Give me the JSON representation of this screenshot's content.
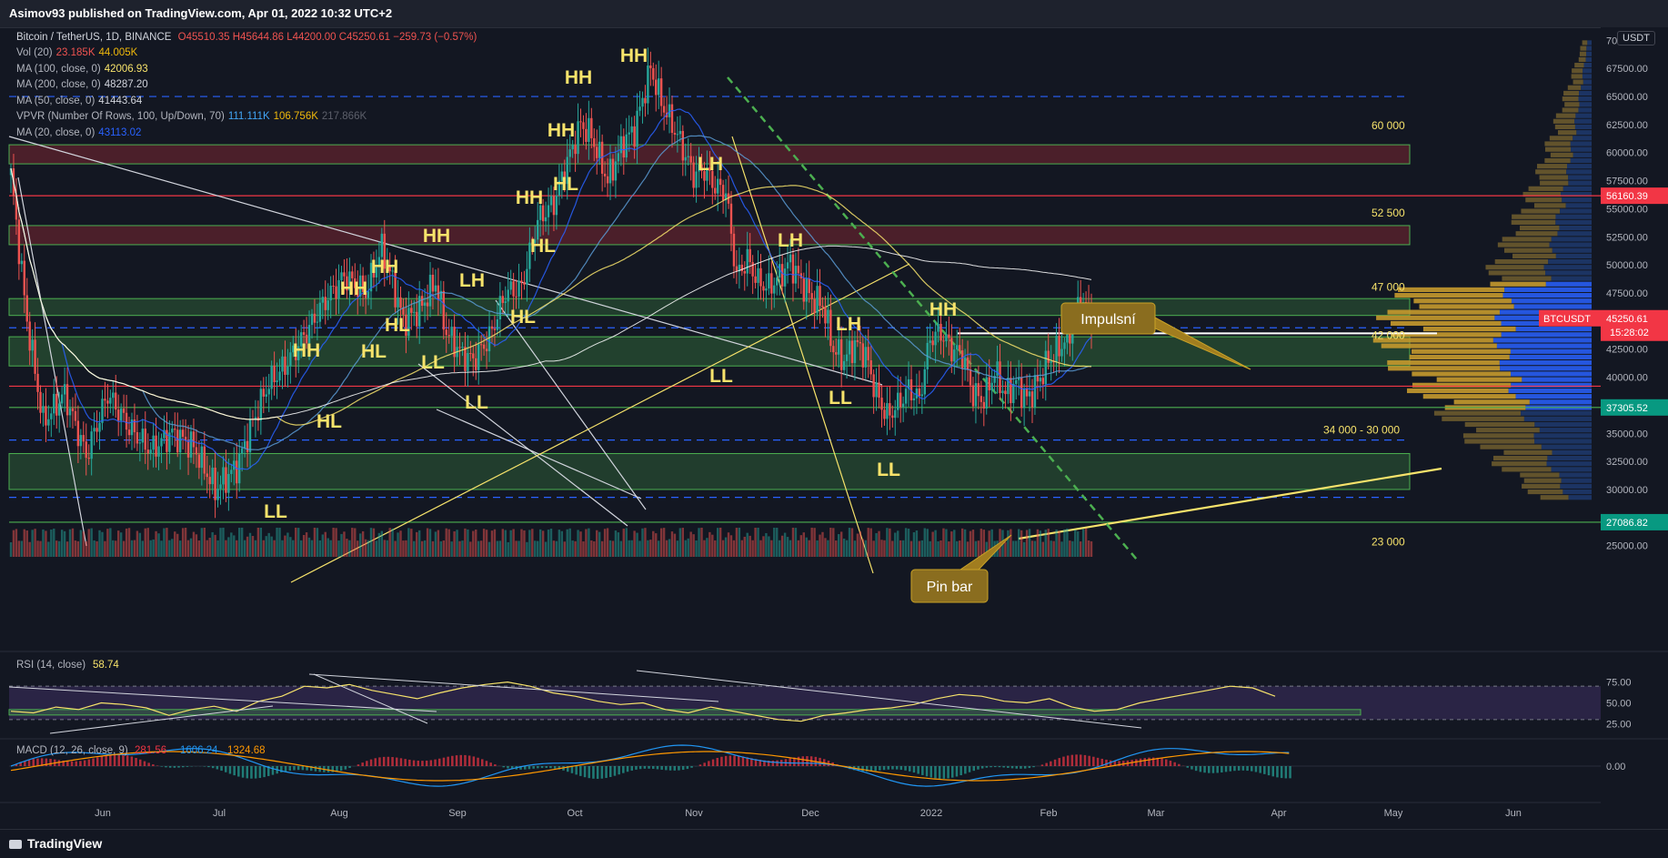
{
  "header": {
    "published": "Asimov93 published on TradingView.com, Apr 01, 2022 10:32 UTC+2"
  },
  "legend": {
    "symbol": {
      "name": "Bitcoin / TetherUS, 1D, BINANCE",
      "ohlc": "O45510.35  H45644.86  L44200.00  C45250.61  −259.73 (−0.57%)"
    },
    "rows": [
      {
        "label": "Vol (20)",
        "v1": "23.185K",
        "v2": "44.005K",
        "c1": "#ef5350",
        "c2": "#f0b90b"
      },
      {
        "label": "MA (100, close, 0)",
        "v1": "42006.93",
        "v2": "",
        "c1": "#f7e36b",
        "c2": ""
      },
      {
        "label": "MA (200, close, 0)",
        "v1": "48287.20",
        "v2": "",
        "c1": "#d1d4dc",
        "c2": ""
      },
      {
        "label": "MA (50, close, 0)",
        "v1": "41443.64",
        "v2": "",
        "c1": "#d1d4dc",
        "c2": ""
      },
      {
        "label": "VPVR (Number Of Rows, 100, Up/Down, 70)",
        "v1": "111.111K",
        "v2": "106.756K",
        "c1": "#42a5f5",
        "c2": "#f0b90b"
      },
      {
        "label": "MA (20, close, 0)",
        "v1": "43113.02",
        "v2": "",
        "c1": "#2962ff",
        "c2": ""
      }
    ],
    "vpvr_total": "217.866K"
  },
  "currency_badge": "USDT",
  "chart_data": {
    "type": "candlestick",
    "symbol": "BTCUSDT",
    "x_ticks": [
      "Jun",
      "Jul",
      "Aug",
      "Sep",
      "Oct",
      "Nov",
      "Dec",
      "2022",
      "Feb",
      "Mar",
      "Apr",
      "May",
      "Jun"
    ],
    "y_ticks": [
      "70000.00",
      "67500.00",
      "65000.00",
      "62500.00",
      "60000.00",
      "57500.00",
      "55000.00",
      "52500.00",
      "50000.00",
      "47500.00",
      "45000.00",
      "42500.00",
      "40000.00",
      "37500.00",
      "35000.00",
      "32500.00",
      "30000.00",
      "27500.00",
      "25000.00"
    ],
    "y_range": [
      24000,
      71000
    ],
    "price_path": [
      [
        0,
        58000
      ],
      [
        6,
        45000
      ],
      [
        12,
        36000
      ],
      [
        20,
        38500
      ],
      [
        28,
        33000
      ],
      [
        36,
        38500
      ],
      [
        44,
        35500
      ],
      [
        52,
        33500
      ],
      [
        60,
        35000
      ],
      [
        68,
        33800
      ],
      [
        76,
        30000
      ],
      [
        84,
        32000
      ],
      [
        90,
        36000
      ],
      [
        96,
        39500
      ],
      [
        102,
        41000
      ],
      [
        110,
        44000
      ],
      [
        116,
        46500
      ],
      [
        124,
        49000
      ],
      [
        132,
        47500
      ],
      [
        138,
        51500
      ],
      [
        142,
        48500
      ],
      [
        146,
        45000
      ],
      [
        152,
        46000
      ],
      [
        158,
        48500
      ],
      [
        162,
        44000
      ],
      [
        168,
        42000
      ],
      [
        172,
        41500
      ],
      [
        178,
        43500
      ],
      [
        184,
        47500
      ],
      [
        190,
        48000
      ],
      [
        196,
        54000
      ],
      [
        202,
        55500
      ],
      [
        206,
        58500
      ],
      [
        212,
        62500
      ],
      [
        216,
        61500
      ],
      [
        222,
        57500
      ],
      [
        228,
        61000
      ],
      [
        232,
        62000
      ],
      [
        238,
        67500
      ],
      [
        242,
        64500
      ],
      [
        248,
        61500
      ],
      [
        254,
        58000
      ],
      [
        258,
        58500
      ],
      [
        262,
        57000
      ],
      [
        266,
        56500
      ],
      [
        270,
        49000
      ],
      [
        274,
        50500
      ],
      [
        278,
        48500
      ],
      [
        282,
        48000
      ],
      [
        286,
        49000
      ],
      [
        290,
        50200
      ],
      [
        294,
        48500
      ],
      [
        298,
        47000
      ],
      [
        302,
        46500
      ],
      [
        306,
        42500
      ],
      [
        310,
        41500
      ],
      [
        314,
        43000
      ],
      [
        318,
        42000
      ],
      [
        322,
        38500
      ],
      [
        326,
        36500
      ],
      [
        330,
        37500
      ],
      [
        334,
        39000
      ],
      [
        338,
        38000
      ],
      [
        342,
        43500
      ],
      [
        346,
        44000
      ],
      [
        350,
        42500
      ],
      [
        354,
        42000
      ],
      [
        358,
        38500
      ],
      [
        362,
        38000
      ],
      [
        366,
        40500
      ],
      [
        370,
        38500
      ],
      [
        374,
        39500
      ],
      [
        378,
        38000
      ],
      [
        382,
        39500
      ],
      [
        386,
        41500
      ],
      [
        390,
        42500
      ],
      [
        394,
        44000
      ],
      [
        398,
        47000
      ],
      [
        402,
        45250
      ]
    ],
    "hlines": [
      {
        "price": 47000,
        "label": "47 000"
      },
      {
        "price": 42000,
        "label": "42 000"
      },
      {
        "price": 52500,
        "label": "52 500"
      },
      {
        "price": 60000,
        "label": "60 000"
      },
      {
        "price": 23000,
        "label": "23 000"
      }
    ],
    "zones_label": "34 000 - 30 000",
    "annotations": [
      {
        "text": "HH"
      },
      {
        "text": "HH"
      },
      {
        "text": "HH"
      },
      {
        "text": "HH"
      },
      {
        "text": "HH"
      },
      {
        "text": "HH"
      },
      {
        "text": "HH"
      },
      {
        "text": "HH"
      },
      {
        "text": "HH"
      },
      {
        "text": "HL"
      },
      {
        "text": "HL"
      },
      {
        "text": "HL"
      },
      {
        "text": "HL"
      },
      {
        "text": "HL"
      },
      {
        "text": "HL"
      },
      {
        "text": "LH"
      },
      {
        "text": "LH"
      },
      {
        "text": "LH"
      },
      {
        "text": "LH"
      },
      {
        "text": "LL"
      },
      {
        "text": "LL"
      },
      {
        "text": "LL"
      },
      {
        "text": "LL"
      },
      {
        "text": "LL"
      },
      {
        "text": "LL"
      },
      {
        "text": "LL"
      }
    ],
    "callouts": [
      {
        "text": "Impulsní"
      },
      {
        "text": "Pin bar"
      }
    ],
    "price_badges": [
      {
        "price": 56160.39,
        "text": "56160.39",
        "color": "#f23645"
      },
      {
        "price": 45250.61,
        "text": "BTCUSDT",
        "text2": "45250.61",
        "sub": "15:28:02",
        "color": "#f23645"
      },
      {
        "price": 37305.52,
        "text": "37305.52",
        "color": "#089981"
      },
      {
        "price": 27086.82,
        "text": "27086.82",
        "color": "#089981"
      }
    ]
  },
  "rsi": {
    "label": "RSI (14, close)",
    "value": "58.74",
    "ticks": [
      "75.00",
      "50.00",
      "25.00"
    ],
    "values": [
      40,
      38,
      45,
      42,
      50,
      48,
      44,
      35,
      42,
      46,
      40,
      52,
      58,
      70,
      68,
      72,
      65,
      60,
      55,
      62,
      68,
      72,
      75,
      70,
      62,
      58,
      52,
      48,
      50,
      42,
      38,
      45,
      40,
      35,
      30,
      28,
      35,
      38,
      42,
      44,
      48,
      55,
      60,
      58,
      52,
      50,
      55,
      45,
      40,
      42,
      50,
      55,
      60,
      65,
      70,
      68,
      58
    ]
  },
  "macd": {
    "label": "MACD (12, 26, close, 9)",
    "v1": "281.56",
    "v2": "1606.24",
    "v3": "1324.68",
    "ticks": [
      "0.00"
    ]
  },
  "footer": {
    "brand": "TradingView"
  }
}
